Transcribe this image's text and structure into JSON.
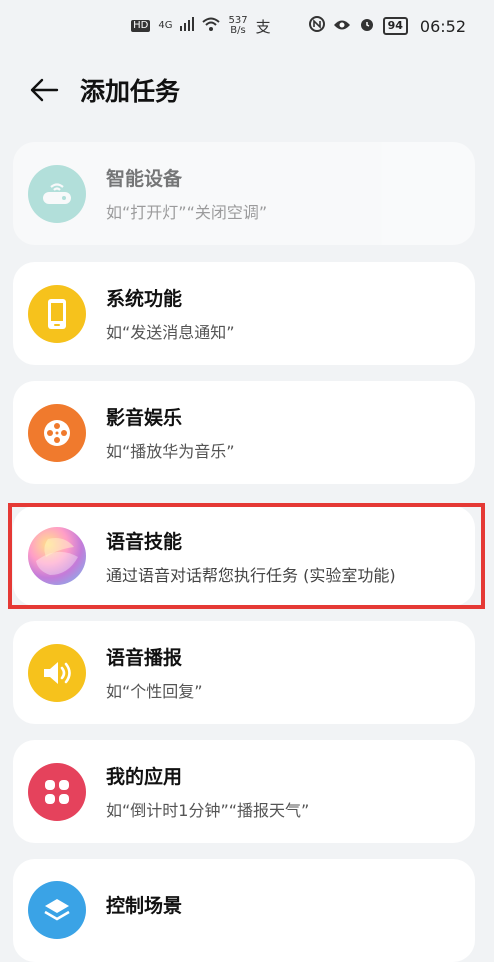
{
  "status": {
    "hd": "HD",
    "net": "4G",
    "speed_top": "537",
    "speed_bottom": "B/s",
    "battery": "94",
    "time": "06:52"
  },
  "header": {
    "back_icon": "arrow-left-icon",
    "title": "添加任务"
  },
  "items": [
    {
      "name": "智能设备",
      "desc": "如“打开灯”“关闭空调”",
      "icon": "smart-device-icon",
      "color": "#7fd0c5",
      "disabled": true
    },
    {
      "name": "系统功能",
      "desc": "如“发送消息通知”",
      "icon": "phone-icon",
      "color": "#f6c21c"
    },
    {
      "name": "影音娱乐",
      "desc": "如“播放华为音乐”",
      "icon": "film-reel-icon",
      "color": "#f07a2d"
    },
    {
      "name": "语音技能",
      "desc": "通过语音对话帮您执行任务 (实验室功能)",
      "icon": "voice-orb-icon",
      "color": "#c47bd9"
    },
    {
      "name": "语音播报",
      "desc": "如“个性回复”",
      "icon": "speaker-icon",
      "color": "#f6c21c"
    },
    {
      "name": "我的应用",
      "desc": "如“倒计时1分钟”“播报天气”",
      "icon": "apps-grid-icon",
      "color": "#e5425c"
    },
    {
      "name": "控制场景",
      "desc": "",
      "icon": "scene-icon",
      "color": "#3aa3e6"
    }
  ]
}
